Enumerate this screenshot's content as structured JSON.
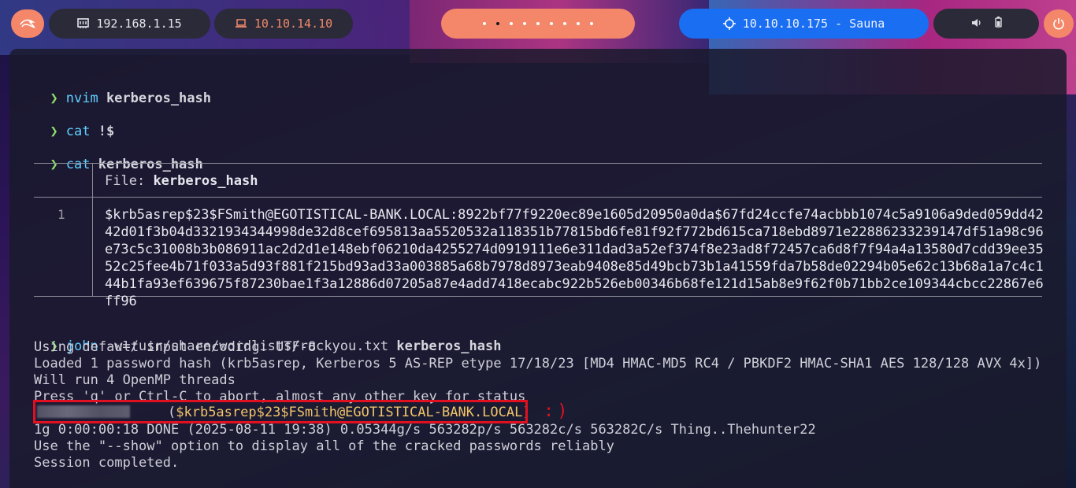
{
  "topbar": {
    "host_ip": "192.168.1.15",
    "vpn_ip": "10.10.14.10",
    "workspaces": 9,
    "active_workspace": 2,
    "target": "10.10.10.175 - Sauna",
    "colors": {
      "accent": "#f4876a",
      "target_bg": "#1a6ef2",
      "pill_bg": "#2a2a38"
    }
  },
  "terminal": {
    "cmd1": {
      "prompt": "❯",
      "cmd": "nvim",
      "arg": "kerberos_hash"
    },
    "cmd2": {
      "prompt": "❯",
      "cmd": "cat",
      "arg": "!$"
    },
    "cmd3": {
      "prompt": "❯",
      "cmd": "cat",
      "arg": "kerberos_hash"
    },
    "bat": {
      "file_label": "File:",
      "file_name": "kerberos_hash",
      "line_no": "1",
      "content": "$krb5asrep$23$FSmith@EGOTISTICAL-BANK.LOCAL:8922bf77f9220ec89e1605d20950a0da$67fd24ccfe74acbbb1074c5a9106a9ded059dd4242d01f3b04d3321934344998de32d8cef695813aa5520532a118351b77815bd6fe81f92f772bd615ca718ebd8971e22886233239147df51a98c96e73c5c31008b3b086911ac2d2d1e148ebf06210da4255274d0919111e6e311dad3a52ef374f8e23ad8f72457ca6d8f7f94a4a13580d7cdd39ee3552c25fee4b71f033a5d93f881f215bd93ad33a003885a68b7978d8973eab9408e85d49bcb73b1a41559fda7b58de02294b05e62c13b68a1a7c4c144b1fa93ef639675f87230bae1f3a12886d07205a87e4add7418ecabc922b526eb00346b68fe121d15ab8e9f62f0b71bb2ce109344cbcc22867e6ff96"
    },
    "cmd4": {
      "prompt": "❯",
      "cmd": "john",
      "opt": "-w=/usr/share/wordlists/rockyou.txt",
      "arg": "kerberos_hash"
    },
    "john_out": {
      "l1": "Using default input encoding: UTF-8",
      "l2": "Loaded 1 password hash (krb5asrep, Kerberos 5 AS-REP etype 17/18/23 [MD4 HMAC-MD5 RC4 / PBKDF2 HMAC-SHA1 AES 128/128 AVX 4x])",
      "l3": "Will run 4 OpenMP threads",
      "l4": "Press 'q' or Ctrl-C to abort, almost any other key for status",
      "cracked_open": "(",
      "cracked_user": "$krb5asrep$23$FSmith@EGOTISTICAL-BANK.LOCAL",
      "cracked_close": ")",
      "smile": ":)",
      "l6": "1g 0:00:00:18 DONE (2025-08-11 19:38) 0.05344g/s 563282p/s 563282c/s 563282C/s Thing..Thehunter22",
      "l7": "Use the \"--show\" option to display all of the cracked passwords reliably",
      "l8": "Session completed."
    }
  }
}
